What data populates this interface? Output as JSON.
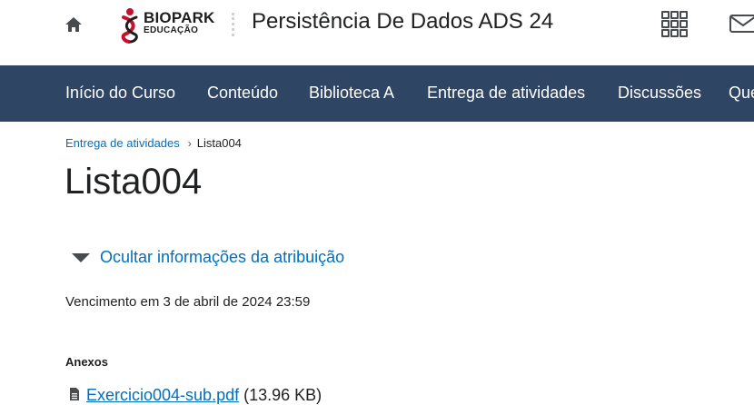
{
  "header": {
    "home_icon": "home-icon",
    "logo": {
      "name": "BIOPARK",
      "subtitle": "EDUCAÇÃO"
    },
    "course_title": "Persistência De Dados ADS 24",
    "apps_icon": "grid-icon",
    "mail_icon": "mail-icon"
  },
  "nav": {
    "items": [
      {
        "label": "Início do Curso"
      },
      {
        "label": "Conteúdo"
      },
      {
        "label": "Biblioteca A"
      },
      {
        "label": "Entrega de atividades"
      },
      {
        "label": "Discussões"
      },
      {
        "label": "Questionários"
      }
    ]
  },
  "breadcrumb": {
    "parent": "Entrega de atividades",
    "separator": "›",
    "current": "Lista004"
  },
  "page": {
    "title": "Lista004",
    "toggle_label": "Ocultar informações da atribuição",
    "due_date": "Vencimento em 3 de abril de 2024 23:59",
    "attachments_heading": "Anexos",
    "attachments": [
      {
        "name": "Exercicio004-sub.pdf",
        "size": "(13.96 KB)",
        "icon": "file-icon"
      }
    ]
  },
  "colors": {
    "nav_bg": "#2e4563",
    "link": "#006fbf",
    "text": "#202122",
    "logo_red": "#c8102e"
  }
}
